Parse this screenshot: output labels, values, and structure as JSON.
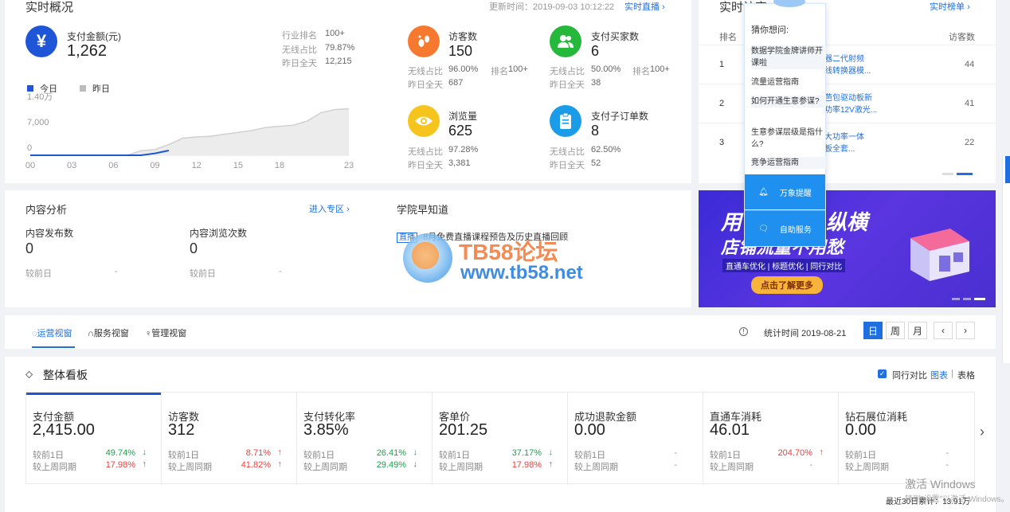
{
  "realtime": {
    "title": "实时概况",
    "update_time": "更新时间：2019-09-03 10:12:22",
    "live_link": "实时直播",
    "pay": {
      "label": "支付金额(元)",
      "value": "1,262",
      "rank_label": "行业排名",
      "rank_value": "100+",
      "wireless_label": "无线占比",
      "wireless_value": "79.87%",
      "yesterday_label": "昨日全天",
      "yesterday_value": "12,215"
    },
    "legend_today": "今日",
    "legend_yesterday": "昨日",
    "chart_colors": {
      "today": "#1f56d8",
      "yesterday": "#d0d0d0"
    },
    "metrics": [
      {
        "label": "访客数",
        "value": "150",
        "wireless_label": "无线占比",
        "wireless_value": "96.00%",
        "rank_label": "排名",
        "rank_value": "100+",
        "yesterday_label": "昨日全天",
        "yesterday_value": "687",
        "icon": "footprint-icon",
        "color": "#f7792f"
      },
      {
        "label": "支付买家数",
        "value": "6",
        "wireless_label": "无线占比",
        "wireless_value": "50.00%",
        "rank_label": "排名",
        "rank_value": "100+",
        "yesterday_label": "昨日全天",
        "yesterday_value": "38",
        "icon": "users-icon",
        "color": "#25b83a"
      },
      {
        "label": "浏览量",
        "value": "625",
        "wireless_label": "无线占比",
        "wireless_value": "97.28%",
        "rank_label": "",
        "rank_value": "",
        "yesterday_label": "昨日全天",
        "yesterday_value": "3,381",
        "icon": "eye-icon",
        "color": "#f5c51d"
      },
      {
        "label": "支付子订单数",
        "value": "8",
        "wireless_label": "无线占比",
        "wireless_value": "62.50%",
        "rank_label": "",
        "rank_value": "",
        "yesterday_label": "昨日全天",
        "yesterday_value": "52",
        "icon": "clipboard-icon",
        "color": "#1b9ce8"
      }
    ]
  },
  "chart_data": {
    "type": "area",
    "x_ticks": [
      "00",
      "03",
      "06",
      "09",
      "12",
      "15",
      "18",
      "23"
    ],
    "y_ticks": [
      "1.40万",
      "7,000",
      "0"
    ],
    "ylim": [
      0,
      14000
    ],
    "series": [
      {
        "name": "今日",
        "x": [
          0,
          1,
          2,
          3,
          4,
          5,
          6,
          7,
          8,
          9,
          10
        ],
        "y": [
          0,
          0,
          0,
          0,
          0,
          0,
          0,
          0,
          0,
          500,
          1262
        ]
      },
      {
        "name": "昨日",
        "x": [
          0,
          1,
          2,
          3,
          4,
          5,
          6,
          7,
          8,
          9,
          10,
          11,
          12,
          13,
          14,
          15,
          16,
          17,
          18,
          19,
          20,
          21,
          22,
          23
        ],
        "y": [
          0,
          0,
          0,
          0,
          0,
          0,
          0,
          0,
          1200,
          1500,
          2800,
          4500,
          4800,
          5000,
          5500,
          6000,
          6500,
          7300,
          7600,
          7900,
          9000,
          11200,
          12000,
          12215
        ]
      }
    ]
  },
  "visitors": {
    "title": "实时访客",
    "link": "实时榜单",
    "col_rank": "排名",
    "col_visitors": "访客数",
    "rows": [
      {
        "rank": "1",
        "line1": "器二代射频",
        "line2": "线转换器模...",
        "visitors": "44"
      },
      {
        "rank": "2",
        "line1": "芭包驱动板新",
        "line2": "功率12V激光...",
        "visitors": "41"
      },
      {
        "rank": "3",
        "line1": "大功率一体",
        "line2": "板全套...",
        "visitors": "22"
      }
    ]
  },
  "popup": {
    "title": "猜你想问:",
    "items": [
      "数据学院金牌讲师开课啦",
      "流量运营指南",
      "如何开通生意参谋?",
      "生意参谋层级是指什么?",
      "竞争运营指南"
    ],
    "btn1": "万象提醒",
    "btn2": "自助服务"
  },
  "content": {
    "title": "内容分析",
    "link": "进入专区",
    "m1_label": "内容发布数",
    "m1_value": "0",
    "m1_cmp": "较前日",
    "m1_cmp_val": "-",
    "m2_label": "内容浏览次数",
    "m2_value": "0",
    "m2_cmp": "较前日",
    "m2_cmp_val": "-"
  },
  "academy": {
    "title": "学院早知道",
    "tag": "直播",
    "text": "8月免费直播课程预告及历史直播回顾"
  },
  "watermark": {
    "line1": "TB58论坛",
    "line2": "www.tb58.net"
  },
  "banner": {
    "line1": "用",
    "line1b": "纵横",
    "line2": "店铺流量不用愁",
    "subtitle": "直通车优化 | 标题优化 | 同行对比",
    "cta": "点击了解更多"
  },
  "views": {
    "tabs": [
      "运营视窗",
      "服务视窗",
      "管理视窗"
    ],
    "stat_time": "统计时间 2019-08-21",
    "periods": [
      "日",
      "周",
      "月"
    ]
  },
  "dashboard": {
    "title": "整体看板",
    "peer_compare": "同行对比",
    "view_chart": "图表",
    "sep": "|",
    "view_table": "表格",
    "kpis": [
      {
        "label": "支付金额",
        "value": "2,415.00",
        "d1_label": "较前1日",
        "d1_value": "49.74%",
        "d1_dir": "down",
        "w_label": "较上周同期",
        "w_value": "17.98%",
        "w_dir": "up"
      },
      {
        "label": "访客数",
        "value": "312",
        "d1_label": "较前1日",
        "d1_value": "8.71%",
        "d1_dir": "up",
        "w_label": "较上周同期",
        "w_value": "41.82%",
        "w_dir": "up"
      },
      {
        "label": "支付转化率",
        "value": "3.85%",
        "d1_label": "较前1日",
        "d1_value": "26.41%",
        "d1_dir": "down",
        "w_label": "较上周同期",
        "w_value": "29.49%",
        "w_dir": "down"
      },
      {
        "label": "客单价",
        "value": "201.25",
        "d1_label": "较前1日",
        "d1_value": "37.17%",
        "d1_dir": "down",
        "w_label": "较上周同期",
        "w_value": "17.98%",
        "w_dir": "up"
      },
      {
        "label": "成功退款金额",
        "value": "0.00",
        "d1_label": "较前1日",
        "d1_value": "-",
        "d1_dir": "",
        "w_label": "较上周同期",
        "w_value": "-",
        "w_dir": ""
      },
      {
        "label": "直通车消耗",
        "value": "46.01",
        "d1_label": "较前1日",
        "d1_value": "204.70%",
        "d1_dir": "up",
        "w_label": "较上周同期",
        "w_value": "-",
        "w_dir": ""
      },
      {
        "label": "钻石展位消耗",
        "value": "0.00",
        "d1_label": "较前1日",
        "d1_value": "-",
        "d1_dir": "",
        "w_label": "较上周同期",
        "w_value": "-",
        "w_dir": ""
      }
    ],
    "footer": "最近30日累计：13.91万"
  },
  "windows": {
    "line1": "激活 Windows",
    "line2": "转到\"设置\"以激活 Windows。"
  }
}
